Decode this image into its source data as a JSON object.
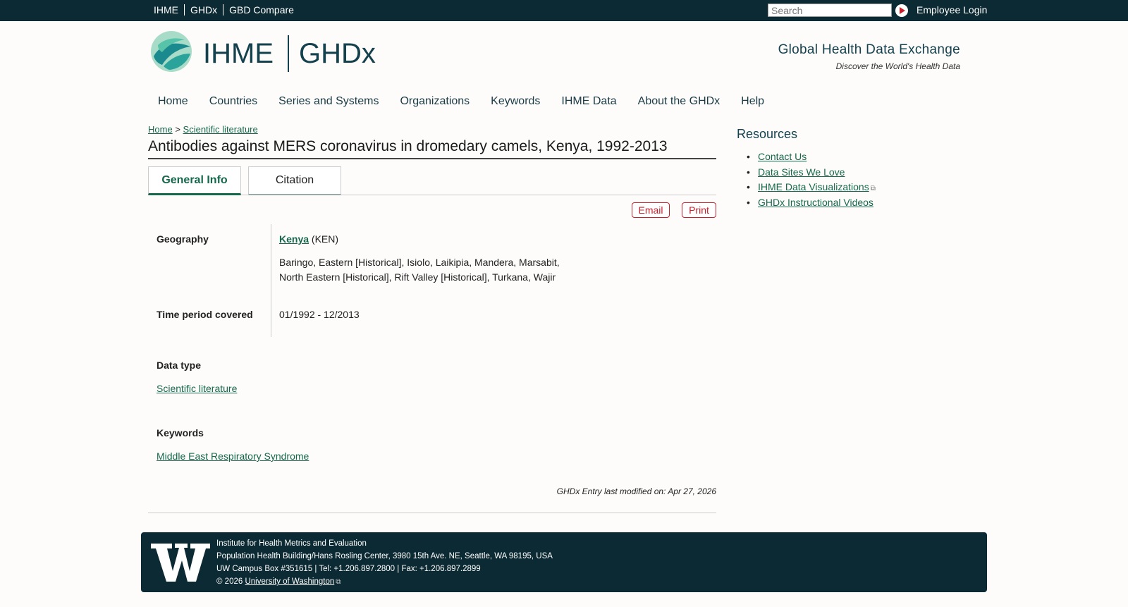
{
  "topbar": {
    "links": [
      "IHME",
      "GHDx",
      "GBD Compare"
    ],
    "search_placeholder": "Search",
    "employee_login": "Employee Login"
  },
  "header": {
    "brand_left": "IHME",
    "brand_right": "GHDx",
    "tagline_title": "Global Health Data Exchange",
    "tagline_sub": "Discover the World's Health Data"
  },
  "nav": [
    "Home",
    "Countries",
    "Series and Systems",
    "Organizations",
    "Keywords",
    "IHME Data",
    "About the GHDx",
    "Help"
  ],
  "breadcrumb": {
    "home": "Home",
    "sep": ">",
    "section": "Scientific literature"
  },
  "page_title": "Antibodies against MERS coronavirus in dromedary camels, Kenya, 1992-2013",
  "tabs": [
    "General Info",
    "Citation"
  ],
  "actions": {
    "email": "Email",
    "print": "Print"
  },
  "geography": {
    "label": "Geography",
    "country": "Kenya",
    "code": "(KEN)",
    "regions_line1": "Baringo, Eastern [Historical], Isiolo, Laikipia, Mandera, Marsabit,",
    "regions_line2": "North Eastern [Historical], Rift Valley [Historical], Turkana, Wajir"
  },
  "time_period": {
    "label": "Time period covered",
    "value": "01/1992 - 12/2013"
  },
  "data_type": {
    "label": "Data type",
    "value": "Scientific literature"
  },
  "keywords": {
    "label": "Keywords",
    "value": "Middle East Respiratory Syndrome"
  },
  "modified": "GHDx Entry last modified on: Apr 27, 2026",
  "resources": {
    "title": "Resources",
    "items": [
      "Contact Us",
      "Data Sites We Love",
      "IHME Data Visualizations",
      "GHDx Instructional Videos"
    ]
  },
  "footer": {
    "line1": "Institute for Health Metrics and Evaluation",
    "line2": "Population Health Building/Hans Rosling Center, 3980 15th Ave. NE, Seattle, WA 98195, USA",
    "line3": "UW Campus Box #351615 | Tel: +1.206.897.2800 | Fax: +1.206.897.2899",
    "copyright": "© 2026",
    "uw_link": "University of Washington"
  },
  "colors": {
    "topbar": "#0c2a33",
    "link": "#16684d",
    "accent_red": "#c8202b"
  }
}
